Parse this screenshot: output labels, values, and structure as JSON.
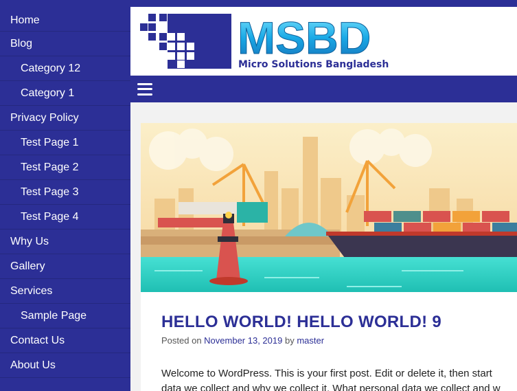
{
  "sidebar": {
    "items": [
      {
        "label": "Home",
        "level": "top"
      },
      {
        "label": "Blog",
        "level": "top"
      },
      {
        "label": "Category 12",
        "level": "sub"
      },
      {
        "label": "Category 1",
        "level": "sub"
      },
      {
        "label": "Privacy Policy",
        "level": "top"
      },
      {
        "label": "Test Page 1",
        "level": "sub"
      },
      {
        "label": "Test Page 2",
        "level": "sub"
      },
      {
        "label": "Test Page 3",
        "level": "sub"
      },
      {
        "label": "Test Page 4",
        "level": "sub"
      },
      {
        "label": "Why Us",
        "level": "top"
      },
      {
        "label": "Gallery",
        "level": "top"
      },
      {
        "label": "Services",
        "level": "top"
      },
      {
        "label": "Sample Page",
        "level": "sub"
      },
      {
        "label": "Contact Us",
        "level": "top"
      },
      {
        "label": "About Us",
        "level": "top"
      }
    ]
  },
  "header": {
    "logo_text": "MSBD",
    "logo_tagline": "Micro Solutions Bangladesh",
    "menu_icon": "hamburger-icon"
  },
  "post": {
    "title": "HELLO WORLD! HELLO WORLD! 9",
    "meta_prefix": "Posted on",
    "date": "November 13, 2019",
    "meta_by": "by",
    "author": "master",
    "excerpt_line1": "Welcome to WordPress. This is your first post. Edit or delete it, then start",
    "excerpt_line2": "data we collect and why we collect it. What personal data we collect and w"
  },
  "colors": {
    "brand": "#2c2f96",
    "sidebar_bg": "#2c2f96",
    "water": "#3ad6c9"
  }
}
